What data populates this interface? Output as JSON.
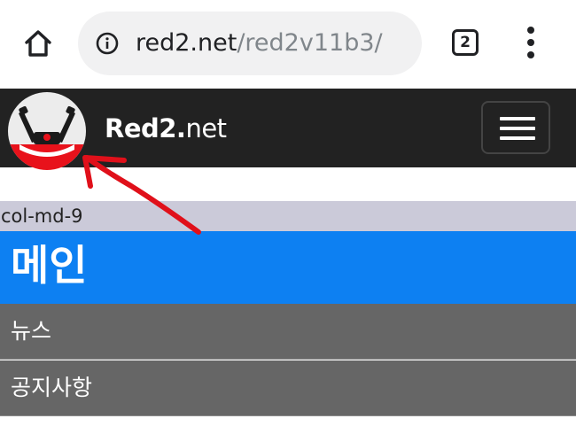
{
  "browser": {
    "url_host": "red2.net",
    "url_path": "/red2v11b3/",
    "tab_count": "2",
    "icons": {
      "home": "home-icon",
      "info": "info-icon",
      "menu": "more-vert-icon"
    }
  },
  "navbar": {
    "brand_bold": "Red2.",
    "brand_rest": "net",
    "logo": "robot-logo",
    "toggle": "hamburger-icon"
  },
  "content": {
    "col_label": "col-md-9",
    "main_title": "메인",
    "menu_items": [
      "뉴스",
      "공지사항"
    ]
  },
  "colors": {
    "navbar_bg": "#222222",
    "main_header_bg": "#0d80f2",
    "menu_item_bg": "#666666",
    "col_label_bg": "#cbcad9",
    "annotation_arrow": "#e0101a"
  }
}
